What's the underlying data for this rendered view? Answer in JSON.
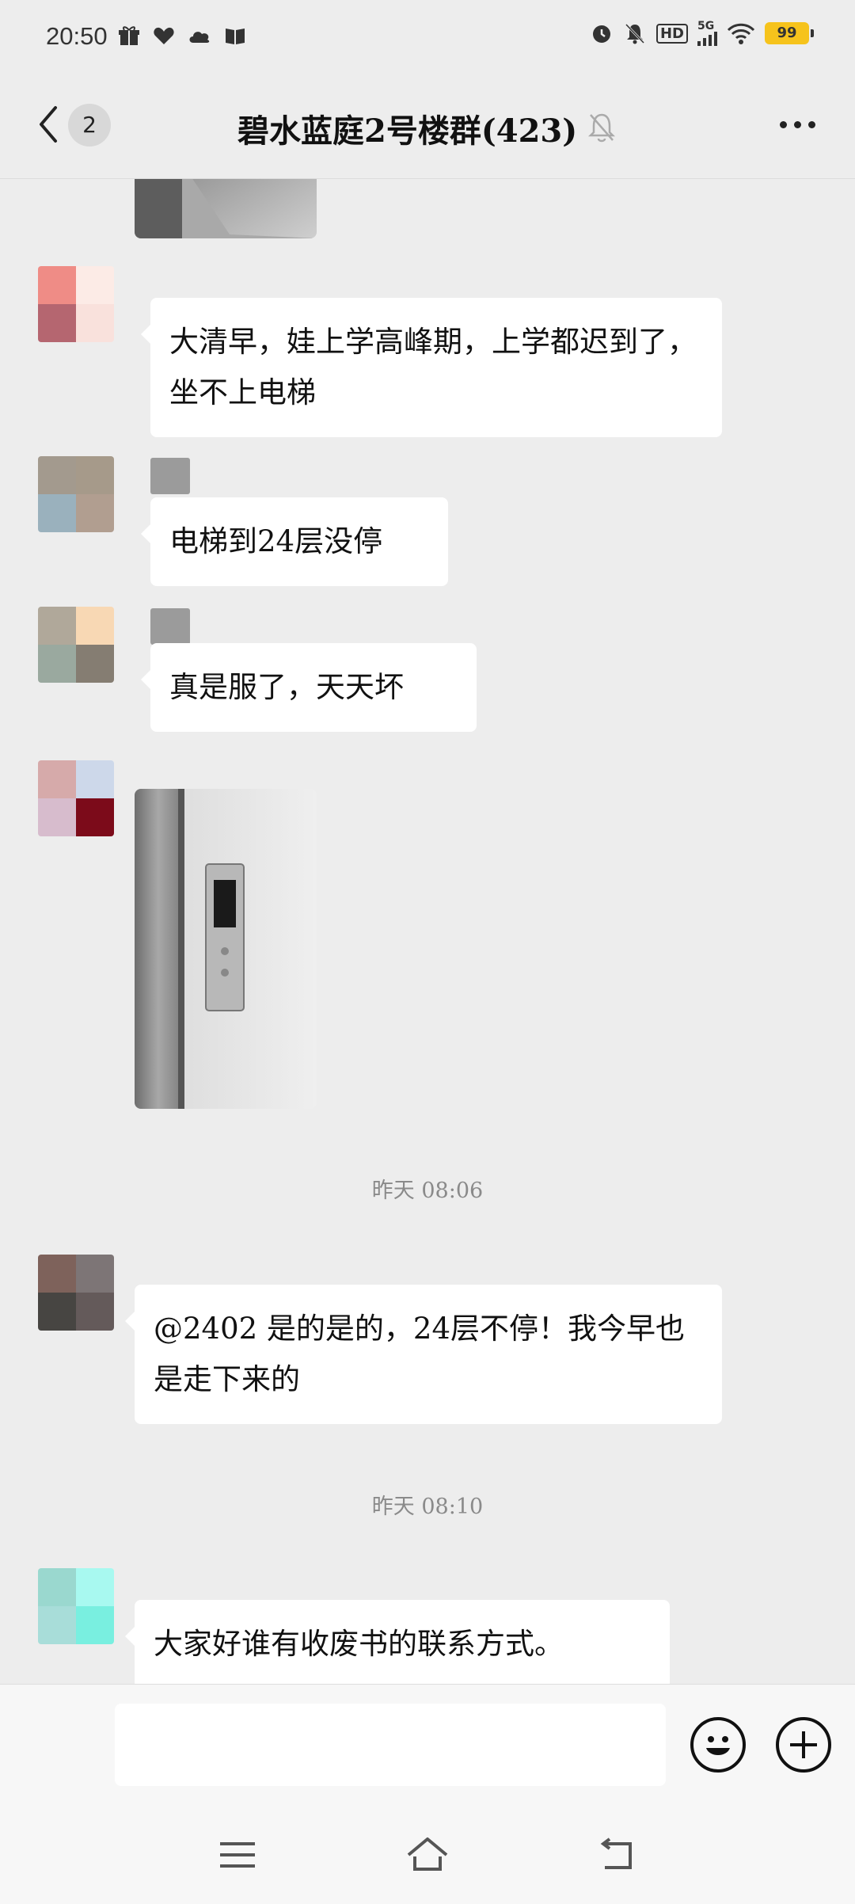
{
  "status_bar": {
    "time": "20:50",
    "network": "5G",
    "hd": "HD",
    "battery": "99"
  },
  "header": {
    "back_count": "2",
    "title": "碧水蓝庭2号楼群(423)"
  },
  "messages": [
    {
      "type": "image",
      "description": "elevator-photo-partial"
    },
    {
      "type": "text",
      "text": "大清早，娃上学高峰期，上学都迟到了，坐不上电梯"
    },
    {
      "type": "text",
      "text": "电梯到24层没停"
    },
    {
      "type": "text",
      "text": "真是服了，天天坏"
    },
    {
      "type": "image",
      "description": "elevator-call-panel-photo"
    },
    {
      "type": "timestamp",
      "text": "昨天 08:06"
    },
    {
      "type": "text",
      "text": "@2402 是的是的，24层不停！我今早也是走下来的"
    },
    {
      "type": "timestamp",
      "text": "昨天 08:10"
    },
    {
      "type": "text",
      "text": "大家好谁有收废书的联系方式。"
    }
  ],
  "input": {
    "placeholder": ""
  },
  "icons": {
    "back": "chevron-left-icon",
    "mute": "bell-off-icon",
    "more": "more-icon",
    "emoji": "smiley-icon",
    "plus": "plus-icon",
    "menu": "menu-icon",
    "home": "home-icon",
    "return": "return-icon"
  },
  "colors": {
    "background": "#ededed",
    "bubble": "#ffffff",
    "battery": "#f6c31c"
  }
}
